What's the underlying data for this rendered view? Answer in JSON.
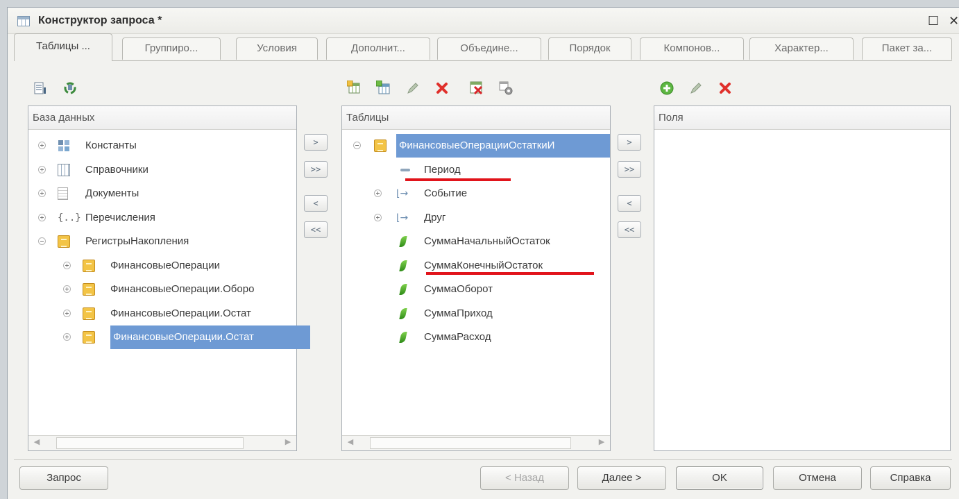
{
  "window": {
    "title": "Конструктор запроса *",
    "maximize_glyph": "☐",
    "close_glyph": "✕"
  },
  "tabs": [
    {
      "label": "Таблицы ...",
      "active": true
    },
    {
      "label": "Группиро..."
    },
    {
      "label": "Условия"
    },
    {
      "label": "Дополнит..."
    },
    {
      "label": "Объедине..."
    },
    {
      "label": "Порядок"
    },
    {
      "label": "Компонов..."
    },
    {
      "label": "Характер..."
    },
    {
      "label": "Пакет за..."
    }
  ],
  "database_panel": {
    "header": "База данных",
    "items": [
      {
        "label": "Константы",
        "icon": "constants-icon",
        "expander": "plus"
      },
      {
        "label": "Справочники",
        "icon": "catalog-icon",
        "expander": "plus"
      },
      {
        "label": "Документы",
        "icon": "document-icon",
        "expander": "plus"
      },
      {
        "label": "Перечисления",
        "icon": "enum-icon",
        "expander": "plus"
      },
      {
        "label": "РегистрыНакопления",
        "icon": "register-icon",
        "expander": "minus"
      },
      {
        "label": "ФинансовыеОперации",
        "icon": "register-icon",
        "expander": "plus",
        "child": true
      },
      {
        "label": "ФинансовыеОперации.Оборо",
        "icon": "register-icon",
        "expander": "plus",
        "child": true
      },
      {
        "label": "ФинансовыеОперации.Остат",
        "icon": "register-icon",
        "expander": "plus",
        "child": true
      },
      {
        "label": "ФинансовыеОперации.Остат",
        "icon": "register-icon",
        "expander": "plus",
        "child": true,
        "selected": true
      }
    ]
  },
  "move_buttons_left": [
    ">",
    ">>",
    "<",
    "<<"
  ],
  "tables_panel": {
    "header": "Таблицы",
    "items": [
      {
        "label": "ФинансовыеОперацииОстаткиИ",
        "icon": "register-icon",
        "expander": "minus",
        "selected": true
      },
      {
        "label": "Период",
        "icon": "dimension-icon",
        "underlined": true
      },
      {
        "label": "Событие",
        "icon": "link-icon",
        "expander": "plus"
      },
      {
        "label": "Друг",
        "icon": "link-icon",
        "expander": "plus"
      },
      {
        "label": "СуммаНачальныйОстаток",
        "icon": "resource-icon"
      },
      {
        "label": "СуммаКонечныйОстаток",
        "icon": "resource-icon",
        "underlined": true
      },
      {
        "label": "СуммаОборот",
        "icon": "resource-icon"
      },
      {
        "label": "СуммаПриход",
        "icon": "resource-icon"
      },
      {
        "label": "СуммаРасход",
        "icon": "resource-icon"
      }
    ]
  },
  "move_buttons_right": [
    ">",
    ">>",
    "<",
    "<<"
  ],
  "fields_panel": {
    "header": "Поля",
    "items": []
  },
  "footer": {
    "query_button": "Запрос",
    "back_button": "< Назад",
    "next_button": "Далее >",
    "ok_button": "OK",
    "cancel_button": "Отмена",
    "help_button": "Справка"
  },
  "colors": {
    "selection": "#6e9ad4",
    "highlight_underline": "#e1141b"
  }
}
